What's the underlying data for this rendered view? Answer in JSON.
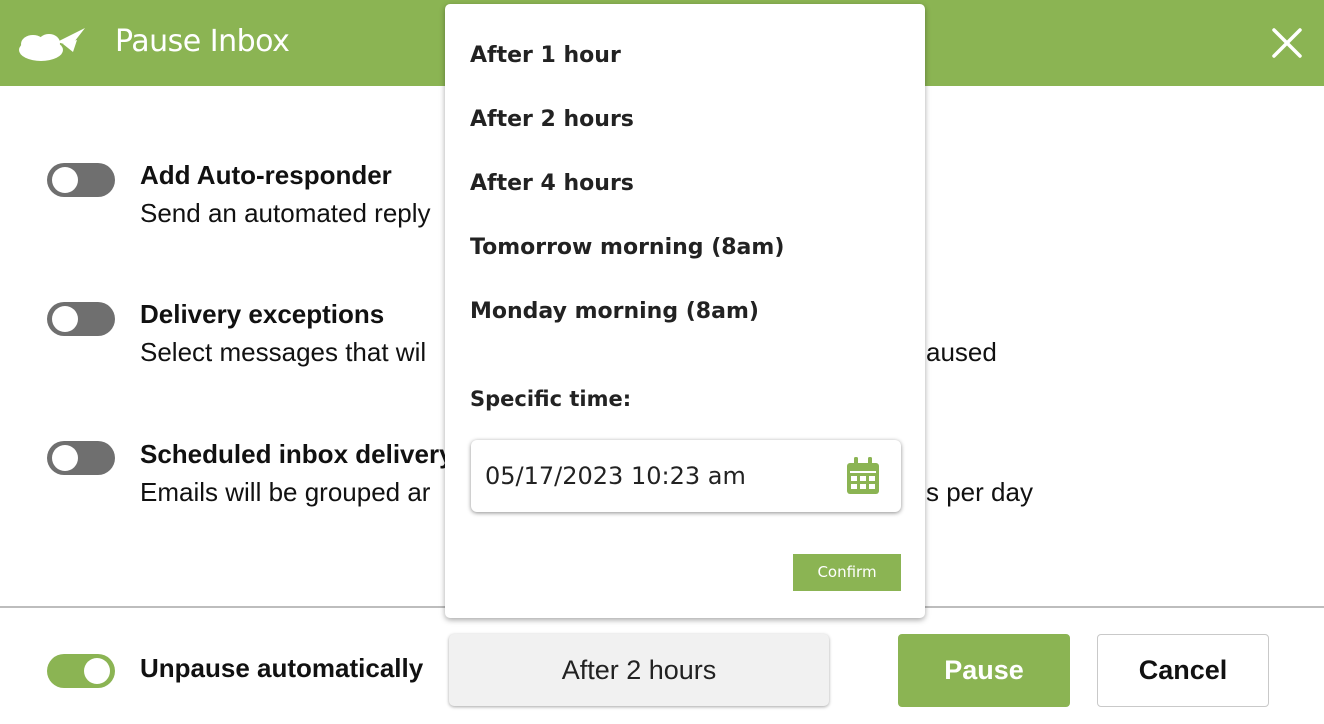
{
  "header": {
    "title": "Pause Inbox",
    "logo_icon": "cloud-plane-logo",
    "close_icon": "close-icon"
  },
  "options": [
    {
      "title": "Add Auto-responder",
      "description": "Send an automated reply",
      "enabled": false
    },
    {
      "title": "Delivery exceptions",
      "description": "Select messages that wil",
      "description_tail": "aused",
      "enabled": false
    },
    {
      "title": "Scheduled inbox delivery",
      "description": "Emails will be grouped ar",
      "description_tail": "s per day",
      "enabled": false
    }
  ],
  "footer": {
    "unpause_label": "Unpause automatically",
    "unpause_enabled": true,
    "selected_duration": "After 2 hours",
    "pause_label": "Pause",
    "cancel_label": "Cancel"
  },
  "dropdown": {
    "items": [
      "After 1 hour",
      "After 2 hours",
      "After 4 hours",
      "Tomorrow morning (8am)",
      "Monday morning (8am)"
    ],
    "specific_time_label": "Specific time:",
    "specific_time_value": "05/17/2023 10:23 am",
    "calendar_icon": "calendar-icon",
    "confirm_label": "Confirm"
  },
  "colors": {
    "brand_green": "#8bb453",
    "toggle_off": "#6f6f6f"
  }
}
